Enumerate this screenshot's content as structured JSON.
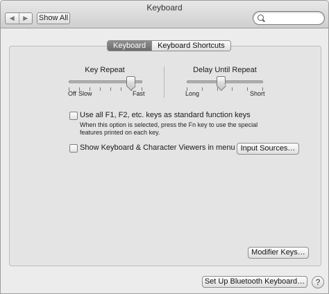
{
  "window": {
    "title": "Keyboard"
  },
  "toolbar": {
    "back_glyph": "◀",
    "forward_glyph": "▶",
    "show_all_label": "Show All",
    "search_value": "",
    "search_placeholder": ""
  },
  "tabs": [
    {
      "label": "Keyboard",
      "active": true
    },
    {
      "label": "Keyboard Shortcuts",
      "active": false
    }
  ],
  "key_repeat": {
    "title": "Key Repeat",
    "off_label": "Off",
    "slow_label": "Slow",
    "fast_label": "Fast",
    "value_fraction": 0.85
  },
  "delay_until_repeat": {
    "title": "Delay Until Repeat",
    "long_label": "Long",
    "short_label": "Short",
    "value_fraction": 0.45
  },
  "fn_keys": {
    "label": "Use all F1, F2, etc. keys as standard function keys",
    "checked": false,
    "help_line1": "When this option is selected, press the Fn key to use the special",
    "help_line2": "features printed on each key."
  },
  "viewers": {
    "label": "Show Keyboard & Character Viewers in menu bar",
    "checked": false
  },
  "buttons": {
    "input_sources": "Input Sources…",
    "modifier_keys": "Modifier Keys…",
    "bluetooth": "Set Up Bluetooth Keyboard…",
    "help_glyph": "?"
  }
}
